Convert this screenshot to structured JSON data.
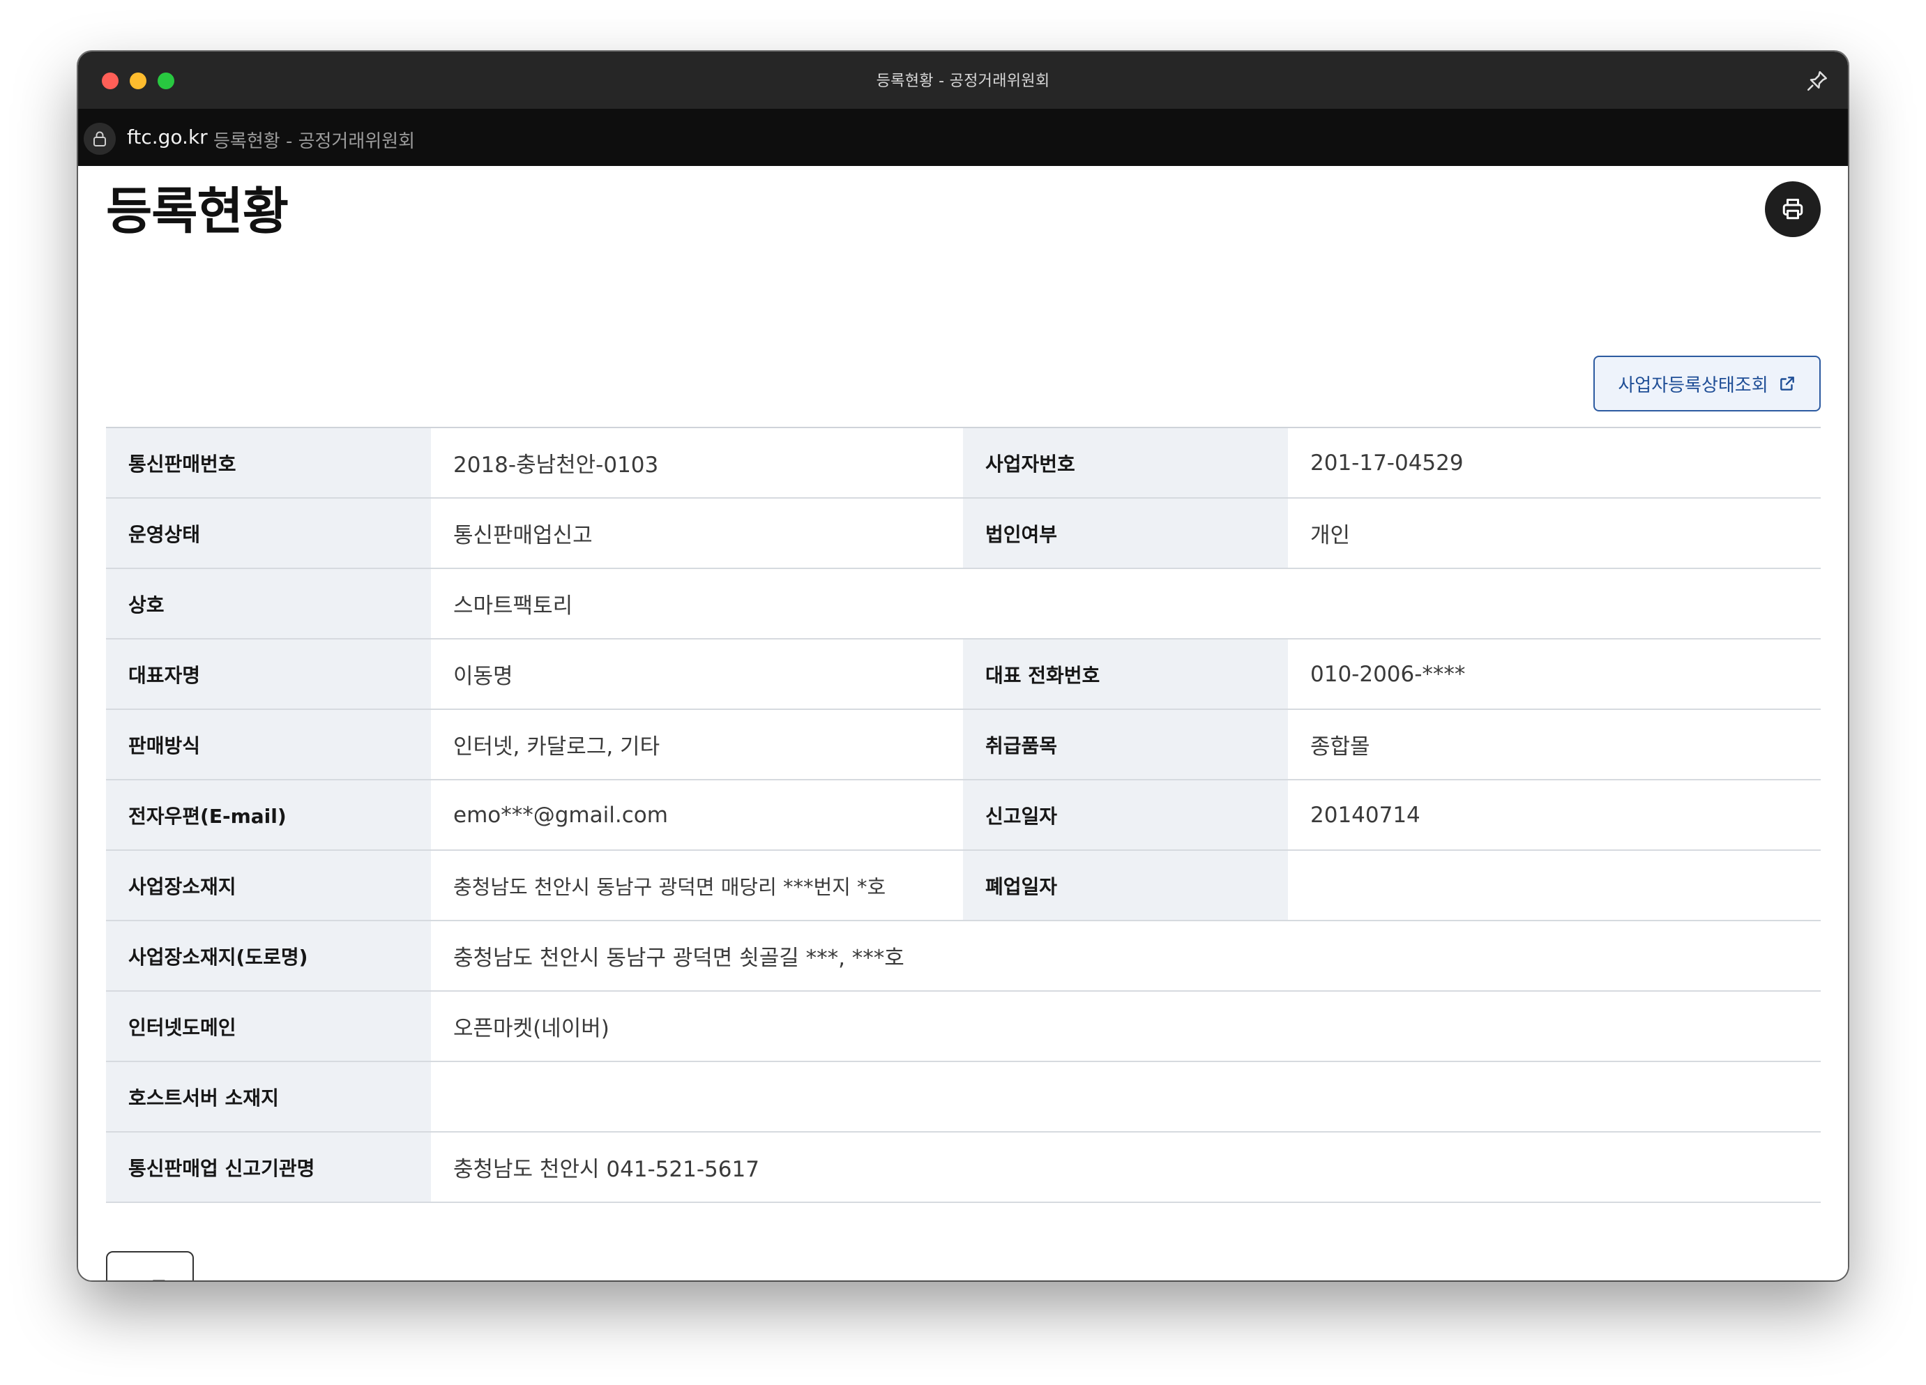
{
  "window": {
    "title": "등록현황 - 공정거래위원회",
    "domain": "ftc.go.kr",
    "page_title_in_url": "등록현황 - 공정거래위원회"
  },
  "page": {
    "heading": "등록현황",
    "print_icon": "printer-icon",
    "status_button_label": "사업자등록상태조회",
    "status_button_icon": "external-link-icon",
    "list_button_label": "목록"
  },
  "info": {
    "mail_order_no_label": "통신판매번호",
    "mail_order_no": "2018-충남천안-0103",
    "business_no_label": "사업자번호",
    "business_no": "201-17-04529",
    "op_status_label": "운영상태",
    "op_status": "통신판매업신고",
    "corp_type_label": "법인여부",
    "corp_type": "개인",
    "trade_name_label": "상호",
    "trade_name": "스마트팩토리",
    "rep_name_label": "대표자명",
    "rep_name": "이동명",
    "rep_phone_label": "대표 전화번호",
    "rep_phone": "010-2006-****",
    "sales_method_label": "판매방식",
    "sales_method": "인터넷, 카달로그, 기타",
    "items_label": "취급품목",
    "items": "종합몰",
    "email_label": "전자우편(E-mail)",
    "email": "emo***@gmail.com",
    "report_date_label": "신고일자",
    "report_date": "20140714",
    "address_label": "사업장소재지",
    "address": "충청남도 천안시 동남구 광덕면 매당리 ***번지 *호",
    "closure_date_label": "폐업일자",
    "closure_date": "",
    "road_address_label": "사업장소재지(도로명)",
    "road_address": "충청남도 천안시 동남구 광덕면 쇳골길 ***, ***호",
    "domain_label": "인터넷도메인",
    "domain": "오픈마켓(네이버)",
    "host_server_label": "호스트서버 소재지",
    "host_server": "",
    "agency_label": "통신판매업 신고기관명",
    "agency": "충청남도 천안시 041-521-5617"
  }
}
